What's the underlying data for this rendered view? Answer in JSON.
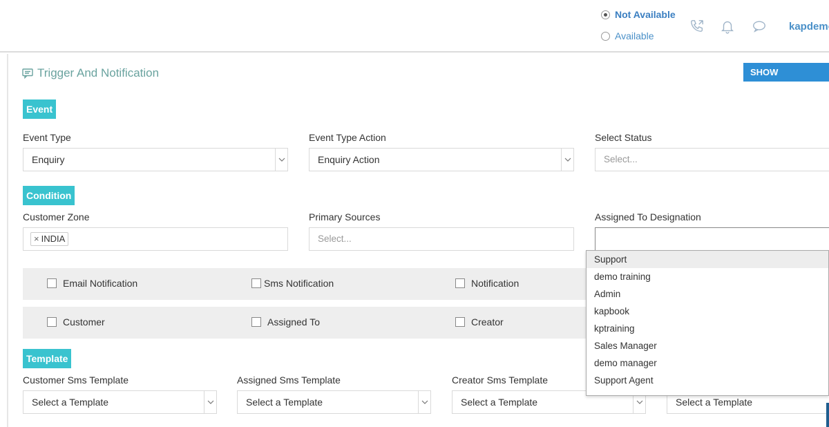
{
  "header": {
    "status_options": [
      {
        "label": "Not Available",
        "checked": true
      },
      {
        "label": "Available",
        "checked": false
      }
    ],
    "icons": [
      "phone-icon",
      "bell-icon",
      "chat-icon"
    ],
    "username": "kapdemo"
  },
  "panel": {
    "title": "Trigger And Notification",
    "show_keywords_label": "SHOW KEYWORDS"
  },
  "event": {
    "tag": "Event",
    "event_type": {
      "label": "Event Type",
      "value": "Enquiry"
    },
    "event_type_action": {
      "label": "Event Type Action",
      "value": "Enquiry Action"
    },
    "select_status": {
      "label": "Select Status",
      "placeholder": "Select..."
    }
  },
  "condition": {
    "tag": "Condition",
    "customer_zone": {
      "label": "Customer Zone",
      "chip": "INDIA"
    },
    "primary_sources": {
      "label": "Primary Sources",
      "placeholder": "Select..."
    },
    "assigned_to_designation": {
      "label": "Assigned To Designation"
    }
  },
  "notifications": {
    "row1": [
      "Email Notification",
      "Sms Notification",
      "Notification"
    ],
    "row2": [
      "Customer",
      "Assigned To",
      "Creator"
    ]
  },
  "template": {
    "tag": "Template",
    "fields": [
      {
        "label": "Customer Sms Template",
        "value": "Select a Template"
      },
      {
        "label": "Assigned Sms Template",
        "value": "Select a Template"
      },
      {
        "label": "Creator Sms Template",
        "value": "Select a Template"
      },
      {
        "label": "",
        "value": "Select a Template"
      }
    ]
  },
  "dropdown": {
    "options": [
      "Support",
      "demo training",
      "Admin",
      "kapbook",
      "kptraining",
      "Sales Manager",
      "demo manager",
      "Support Agent"
    ],
    "highlighted_index": 0
  },
  "colors": {
    "accent_teal": "#39c3cf",
    "button_blue": "#2e8fd6",
    "title_green": "#6aa39f",
    "link_blue": "#4a90c8"
  }
}
